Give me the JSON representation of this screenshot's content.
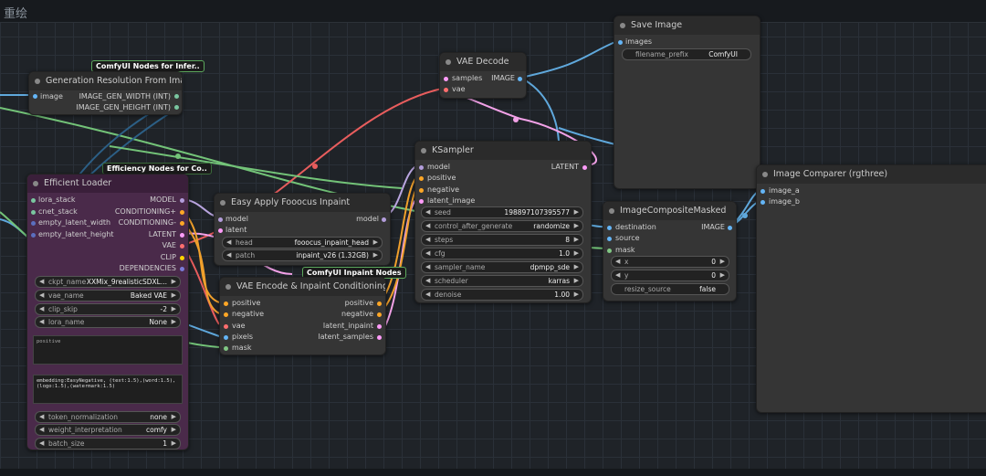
{
  "app": {
    "title": "重绘"
  },
  "badges": {
    "inference": "ComfyUI Nodes for Infer..",
    "efficiency": "Efficiency Nodes for Co..",
    "inpaint_nodes": "ComfyUI Inpaint Nodes"
  },
  "gen_res": {
    "title": "Generation Resolution From Image",
    "input_image": "image",
    "out_width": "IMAGE_GEN_WIDTH (INT)",
    "out_height": "IMAGE_GEN_HEIGHT (INT)"
  },
  "vae_decode": {
    "title": "VAE Decode",
    "in_samples": "samples",
    "in_vae": "vae",
    "out_image": "IMAGE"
  },
  "save_image": {
    "title": "Save Image",
    "in_images": "images",
    "prefix_label": "filename_prefix",
    "prefix_value": "ComfyUI"
  },
  "eff_loader": {
    "title": "Efficient Loader",
    "inputs": [
      "lora_stack",
      "cnet_stack",
      "empty_latent_width",
      "empty_latent_height"
    ],
    "outputs": [
      "MODEL",
      "CONDITIONING+",
      "CONDITIONING-",
      "LATENT",
      "VAE",
      "CLIP",
      "DEPENDENCIES"
    ],
    "ckpt_label": "ckpt_name",
    "ckpt_value": "XXMix_9realisticSDXL...",
    "vae_label": "vae_name",
    "vae_value": "Baked VAE",
    "clip_label": "clip_skip",
    "clip_value": "-2",
    "lora_label": "lora_name",
    "lora_value": "None",
    "positive_placeholder": "positive",
    "negative_text": "embedding:EasyNegative, (text:1.5),(word:1.5),(logo:1.5),(watermark:1.5)",
    "token_label": "token_normalization",
    "token_value": "none",
    "weight_label": "weight_interpretation",
    "weight_value": "comfy",
    "batch_label": "batch_size",
    "batch_value": "1"
  },
  "fooocus": {
    "title": "Easy Apply Fooocus Inpaint",
    "in_model": "model",
    "in_latent": "latent",
    "out_model": "model",
    "head_label": "head",
    "head_value": "fooocus_inpaint_head",
    "patch_label": "patch",
    "patch_value": "inpaint_v26 (1.32GB)"
  },
  "vae_encode": {
    "title": "VAE Encode & Inpaint Conditioning",
    "inputs": [
      "positive",
      "negative",
      "vae",
      "pixels",
      "mask"
    ],
    "outputs": [
      "positive",
      "negative",
      "latent_inpaint",
      "latent_samples"
    ]
  },
  "ksampler": {
    "title": "KSampler",
    "inputs": [
      "model",
      "positive",
      "negative",
      "latent_image"
    ],
    "out_latent": "LATENT",
    "widgets": [
      {
        "label": "seed",
        "value": "198897107395577"
      },
      {
        "label": "control_after_generate",
        "value": "randomize"
      },
      {
        "label": "steps",
        "value": "8"
      },
      {
        "label": "cfg",
        "value": "1.0"
      },
      {
        "label": "sampler_name",
        "value": "dpmpp_sde"
      },
      {
        "label": "scheduler",
        "value": "karras"
      },
      {
        "label": "denoise",
        "value": "1.00"
      }
    ]
  },
  "composite": {
    "title": "ImageCompositeMasked",
    "inputs": [
      "destination",
      "source",
      "mask"
    ],
    "out_image": "IMAGE",
    "x_label": "x",
    "x_value": "0",
    "y_label": "y",
    "y_value": "0",
    "resize_label": "resize_source",
    "resize_value": "false"
  },
  "comparer": {
    "title": "Image Comparer (rgthree)",
    "inputs": [
      "image_a",
      "image_b"
    ]
  },
  "colors": {
    "efficient_loader_bg": "#4a2a4a",
    "model": "#b39ddb",
    "conditioning": "#ffa726",
    "latent": "#ff9cf9",
    "vae": "#ff6e6e",
    "clip": "#ffd500",
    "image": "#64b5f6",
    "mask": "#81c784",
    "int": "#7ac7a0"
  }
}
